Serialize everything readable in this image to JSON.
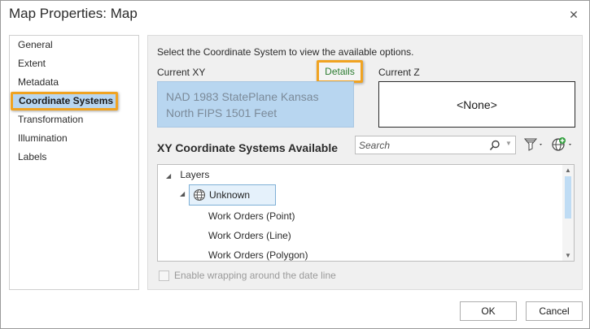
{
  "window": {
    "title": "Map Properties: Map"
  },
  "sidebar": {
    "items": [
      {
        "label": "General"
      },
      {
        "label": "Extent"
      },
      {
        "label": "Metadata"
      },
      {
        "label": "Coordinate Systems",
        "selected": true
      },
      {
        "label": "Transformation"
      },
      {
        "label": "Illumination"
      },
      {
        "label": "Labels"
      }
    ]
  },
  "main": {
    "instruction": "Select the Coordinate System to view the available options.",
    "current_xy_label": "Current XY",
    "details_label": "Details",
    "current_z_label": "Current Z",
    "current_xy_value": "NAD 1983 StatePlane Kansas North FIPS 1501 Feet",
    "current_z_value": "<None>",
    "available_title": "XY Coordinate Systems Available",
    "search_placeholder": "Search",
    "tree": {
      "root": "Layers",
      "group": "Unknown",
      "children": [
        "Work Orders (Point)",
        "Work Orders (Line)",
        "Work Orders (Polygon)"
      ]
    },
    "wrap_label": "Enable wrapping around the date line",
    "wrap_checked": false
  },
  "footer": {
    "ok_label": "OK",
    "cancel_label": "Cancel"
  },
  "colors": {
    "accent_highlight": "#f0a321",
    "selection_blue": "#b8d6f0",
    "details_green": "#2e7d32"
  }
}
